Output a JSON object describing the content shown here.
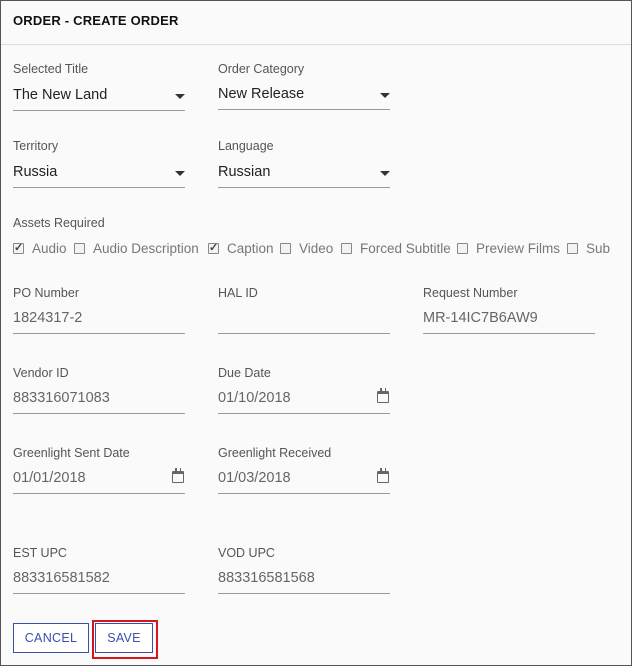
{
  "header": {
    "title": "ORDER - CREATE ORDER"
  },
  "form": {
    "selected_title": {
      "label": "Selected Title",
      "value": "The New Land"
    },
    "order_category": {
      "label": "Order Category",
      "value": "New Release"
    },
    "territory": {
      "label": "Territory",
      "value": "Russia"
    },
    "language": {
      "label": "Language",
      "value": "Russian"
    },
    "assets": {
      "label": "Assets Required",
      "items": [
        {
          "label": "Audio",
          "checked": true
        },
        {
          "label": "Audio Description",
          "checked": false
        },
        {
          "label": "Caption",
          "checked": true
        },
        {
          "label": "Video",
          "checked": false
        },
        {
          "label": "Forced Subtitle",
          "checked": false
        },
        {
          "label": "Preview Films",
          "checked": false
        },
        {
          "label": "Sub",
          "checked": false
        }
      ]
    },
    "po_number": {
      "label": "PO Number",
      "value": "1824317-2"
    },
    "hal_id": {
      "label": "HAL ID",
      "value": ""
    },
    "request_number": {
      "label": "Request Number",
      "value": "MR-14IC7B6AW9"
    },
    "vendor_id": {
      "label": "Vendor ID",
      "value": "883316071083"
    },
    "due_date": {
      "label": "Due Date",
      "value": "01/10/2018"
    },
    "greenlight_sent_date": {
      "label": "Greenlight Sent Date",
      "value": "01/01/2018"
    },
    "greenlight_received": {
      "label": "Greenlight Received",
      "value": "01/03/2018"
    },
    "est_upc": {
      "label": "EST UPC",
      "value": "883316581582"
    },
    "vod_upc": {
      "label": "VOD UPC",
      "value": "883316581568"
    }
  },
  "actions": {
    "cancel_label": "CANCEL",
    "save_label": "SAVE"
  },
  "colors": {
    "accent": "#3a4fa8",
    "highlight": "#d6161c"
  },
  "icons": {
    "dropdown": "chevron-down-icon",
    "date": "calendar-icon"
  }
}
